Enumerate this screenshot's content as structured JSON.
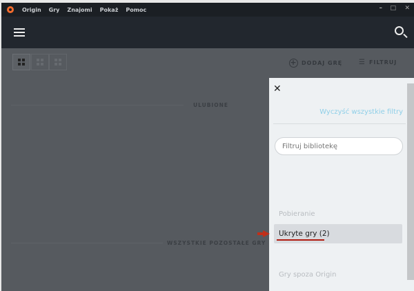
{
  "titlebar": {
    "menu": [
      "Origin",
      "Gry",
      "Znajomi",
      "Pokaż",
      "Pomoc"
    ],
    "minimize": "–",
    "maximize": "□",
    "close": "✕"
  },
  "toolbar": {
    "add_game": "DODAJ GRĘ",
    "filter": "FILTRUJ"
  },
  "sections": {
    "favorites": "ULUBIONE",
    "others": "WSZYSTKIE POZOSTAŁE GRY"
  },
  "panel": {
    "close": "✕",
    "clear_filters": "Wyczyść wszystkie filtry",
    "filter_placeholder": "Filtruj bibliotekę",
    "items": [
      "Pobieranie",
      "Ukryte gry (2)",
      "Gry spoza Origin"
    ]
  },
  "colors": {
    "accent": "#f56c2d",
    "link": "#8fcfe8",
    "annotation": "#b01c10"
  }
}
